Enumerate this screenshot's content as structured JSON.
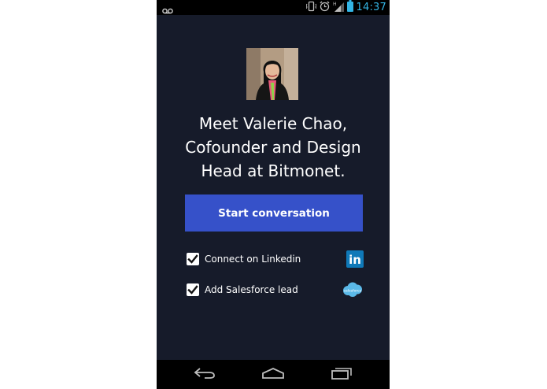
{
  "status_bar": {
    "time": "14:37",
    "icons": [
      "voicemail-icon",
      "vibrate-icon",
      "alarm-icon",
      "signal-icon",
      "battery-icon"
    ],
    "accent_color": "#33b5e5"
  },
  "profile": {
    "avatar_icon": "profile-photo",
    "headline_lines": [
      "Meet Valerie Chao,",
      "Cofounder and Design",
      "Head at Bitmonet."
    ]
  },
  "cta": {
    "label": "Start conversation",
    "color": "#3651c9"
  },
  "options": [
    {
      "label": "Connect on Linkedin",
      "checked": true,
      "icon": "linkedin-icon",
      "icon_text": "in"
    },
    {
      "label": "Add Salesforce lead",
      "checked": true,
      "icon": "salesforce-icon",
      "icon_text": "salesforce"
    }
  ],
  "nav_bar": {
    "buttons": [
      "back-icon",
      "home-icon",
      "recent-apps-icon"
    ]
  },
  "theme": {
    "background": "#161b2a"
  }
}
